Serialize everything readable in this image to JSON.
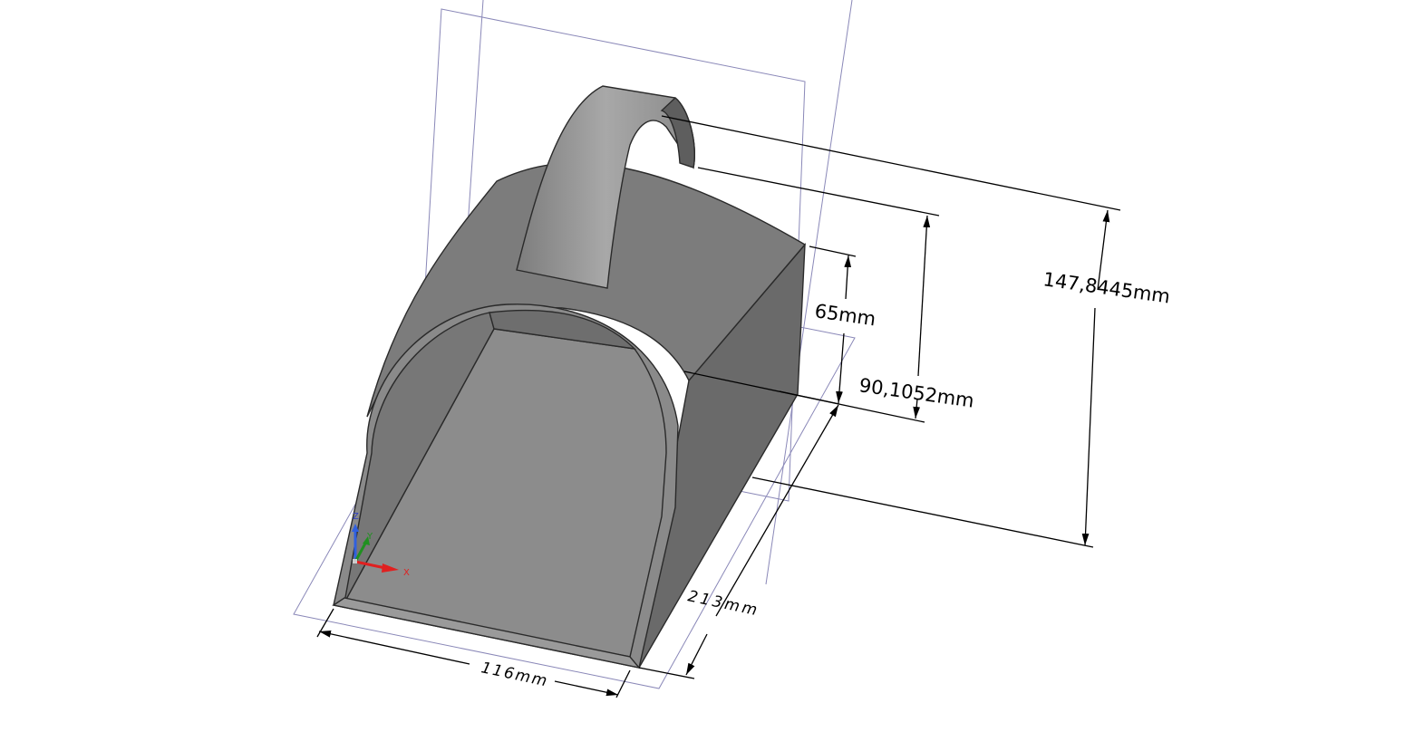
{
  "viewport": {
    "model": "scoop",
    "dimensions": {
      "overall_height": "147,8445mm",
      "handle_height": "90,1052mm",
      "back_height": "65mm",
      "length": "213mm",
      "width": "116mm"
    },
    "axis_triad": {
      "x": "X",
      "y": "Y",
      "z": "Z"
    },
    "colors": {
      "body": "#808080",
      "plane": "#8a88b8",
      "x_axis": "#e02020",
      "y_axis": "#209020",
      "z_axis": "#3060e0"
    }
  }
}
